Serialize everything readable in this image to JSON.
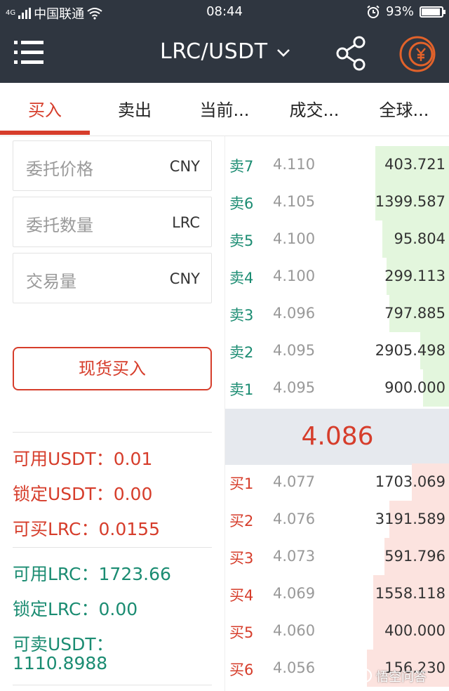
{
  "status_bar": {
    "network": "4G",
    "carrier": "中国联通",
    "time": "08:44",
    "battery_percent": "93%",
    "battery_level": 0.93
  },
  "nav": {
    "title": "LRC/USDT"
  },
  "tabs": [
    {
      "label": "买入",
      "active": true
    },
    {
      "label": "卖出",
      "active": false
    },
    {
      "label": "当前...",
      "active": false
    },
    {
      "label": "成交...",
      "active": false
    },
    {
      "label": "全球...",
      "active": false
    }
  ],
  "form": {
    "price": {
      "placeholder": "委托价格",
      "unit": "CNY"
    },
    "amount": {
      "placeholder": "委托数量",
      "unit": "LRC"
    },
    "volume": {
      "placeholder": "交易量",
      "unit": "CNY"
    },
    "submit_label": "现货买入"
  },
  "balances": {
    "usdt_available": "可用USDT：0.01",
    "usdt_locked": "锁定USDT：0.00",
    "lrc_buyable": "可买LRC：0.0155",
    "lrc_available": "可用LRC：1723.66",
    "lrc_locked": "锁定LRC：0.00",
    "usdt_sellable_label": "可卖USDT：",
    "usdt_sellable_value": "1110.8988"
  },
  "order_book": {
    "asks": [
      {
        "label": "卖7",
        "price": "4.110",
        "qty": "403.721",
        "depth": 0.33
      },
      {
        "label": "卖6",
        "price": "4.105",
        "qty": "1399.587",
        "depth": 0.33
      },
      {
        "label": "卖5",
        "price": "4.100",
        "qty": "95.804",
        "depth": 0.3
      },
      {
        "label": "卖4",
        "price": "4.100",
        "qty": "299.113",
        "depth": 0.28
      },
      {
        "label": "卖3",
        "price": "4.096",
        "qty": "797.885",
        "depth": 0.27
      },
      {
        "label": "卖2",
        "price": "4.095",
        "qty": "2905.498",
        "depth": 0.13
      },
      {
        "label": "卖1",
        "price": "4.095",
        "qty": "900.000",
        "depth": 0.12
      }
    ],
    "last_price": "4.086",
    "bids": [
      {
        "label": "买1",
        "price": "4.077",
        "qty": "1703.069",
        "depth": 0.17
      },
      {
        "label": "买2",
        "price": "4.076",
        "qty": "3191.589",
        "depth": 0.27
      },
      {
        "label": "买3",
        "price": "4.073",
        "qty": "591.796",
        "depth": 0.29
      },
      {
        "label": "买4",
        "price": "4.069",
        "qty": "1558.118",
        "depth": 0.34
      },
      {
        "label": "买5",
        "price": "4.060",
        "qty": "400.000",
        "depth": 0.34
      },
      {
        "label": "买6",
        "price": "4.056",
        "qty": "156.230",
        "depth": 0.37
      }
    ]
  },
  "watermark": "悟空问答",
  "colors": {
    "header_bg": "#2f3640",
    "accent_red": "#d63d2b",
    "accent_green": "#1b8c72",
    "ask_depth": "#e3f6dd",
    "bid_depth": "#fce3df",
    "coin_orange": "#e2622a"
  }
}
